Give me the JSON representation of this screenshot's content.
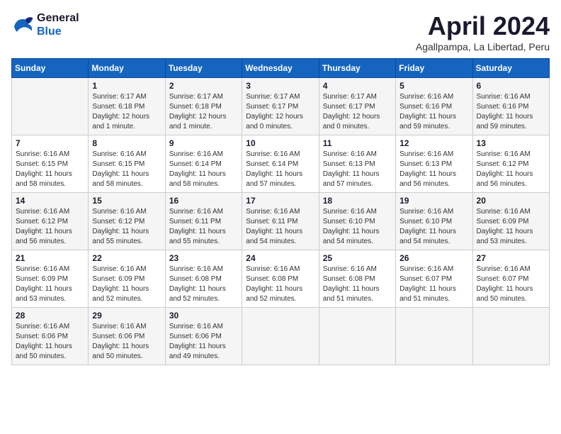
{
  "logo": {
    "line1": "General",
    "line2": "Blue"
  },
  "title": "April 2024",
  "subtitle": "Agallpampa, La Libertad, Peru",
  "days_of_week": [
    "Sunday",
    "Monday",
    "Tuesday",
    "Wednesday",
    "Thursday",
    "Friday",
    "Saturday"
  ],
  "weeks": [
    [
      {
        "day": "",
        "info": ""
      },
      {
        "day": "1",
        "info": "Sunrise: 6:17 AM\nSunset: 6:18 PM\nDaylight: 12 hours\nand 1 minute."
      },
      {
        "day": "2",
        "info": "Sunrise: 6:17 AM\nSunset: 6:18 PM\nDaylight: 12 hours\nand 1 minute."
      },
      {
        "day": "3",
        "info": "Sunrise: 6:17 AM\nSunset: 6:17 PM\nDaylight: 12 hours\nand 0 minutes."
      },
      {
        "day": "4",
        "info": "Sunrise: 6:17 AM\nSunset: 6:17 PM\nDaylight: 12 hours\nand 0 minutes."
      },
      {
        "day": "5",
        "info": "Sunrise: 6:16 AM\nSunset: 6:16 PM\nDaylight: 11 hours\nand 59 minutes."
      },
      {
        "day": "6",
        "info": "Sunrise: 6:16 AM\nSunset: 6:16 PM\nDaylight: 11 hours\nand 59 minutes."
      }
    ],
    [
      {
        "day": "7",
        "info": "Sunrise: 6:16 AM\nSunset: 6:15 PM\nDaylight: 11 hours\nand 58 minutes."
      },
      {
        "day": "8",
        "info": "Sunrise: 6:16 AM\nSunset: 6:15 PM\nDaylight: 11 hours\nand 58 minutes."
      },
      {
        "day": "9",
        "info": "Sunrise: 6:16 AM\nSunset: 6:14 PM\nDaylight: 11 hours\nand 58 minutes."
      },
      {
        "day": "10",
        "info": "Sunrise: 6:16 AM\nSunset: 6:14 PM\nDaylight: 11 hours\nand 57 minutes."
      },
      {
        "day": "11",
        "info": "Sunrise: 6:16 AM\nSunset: 6:13 PM\nDaylight: 11 hours\nand 57 minutes."
      },
      {
        "day": "12",
        "info": "Sunrise: 6:16 AM\nSunset: 6:13 PM\nDaylight: 11 hours\nand 56 minutes."
      },
      {
        "day": "13",
        "info": "Sunrise: 6:16 AM\nSunset: 6:12 PM\nDaylight: 11 hours\nand 56 minutes."
      }
    ],
    [
      {
        "day": "14",
        "info": "Sunrise: 6:16 AM\nSunset: 6:12 PM\nDaylight: 11 hours\nand 56 minutes."
      },
      {
        "day": "15",
        "info": "Sunrise: 6:16 AM\nSunset: 6:12 PM\nDaylight: 11 hours\nand 55 minutes."
      },
      {
        "day": "16",
        "info": "Sunrise: 6:16 AM\nSunset: 6:11 PM\nDaylight: 11 hours\nand 55 minutes."
      },
      {
        "day": "17",
        "info": "Sunrise: 6:16 AM\nSunset: 6:11 PM\nDaylight: 11 hours\nand 54 minutes."
      },
      {
        "day": "18",
        "info": "Sunrise: 6:16 AM\nSunset: 6:10 PM\nDaylight: 11 hours\nand 54 minutes."
      },
      {
        "day": "19",
        "info": "Sunrise: 6:16 AM\nSunset: 6:10 PM\nDaylight: 11 hours\nand 54 minutes."
      },
      {
        "day": "20",
        "info": "Sunrise: 6:16 AM\nSunset: 6:09 PM\nDaylight: 11 hours\nand 53 minutes."
      }
    ],
    [
      {
        "day": "21",
        "info": "Sunrise: 6:16 AM\nSunset: 6:09 PM\nDaylight: 11 hours\nand 53 minutes."
      },
      {
        "day": "22",
        "info": "Sunrise: 6:16 AM\nSunset: 6:09 PM\nDaylight: 11 hours\nand 52 minutes."
      },
      {
        "day": "23",
        "info": "Sunrise: 6:16 AM\nSunset: 6:08 PM\nDaylight: 11 hours\nand 52 minutes."
      },
      {
        "day": "24",
        "info": "Sunrise: 6:16 AM\nSunset: 6:08 PM\nDaylight: 11 hours\nand 52 minutes."
      },
      {
        "day": "25",
        "info": "Sunrise: 6:16 AM\nSunset: 6:08 PM\nDaylight: 11 hours\nand 51 minutes."
      },
      {
        "day": "26",
        "info": "Sunrise: 6:16 AM\nSunset: 6:07 PM\nDaylight: 11 hours\nand 51 minutes."
      },
      {
        "day": "27",
        "info": "Sunrise: 6:16 AM\nSunset: 6:07 PM\nDaylight: 11 hours\nand 50 minutes."
      }
    ],
    [
      {
        "day": "28",
        "info": "Sunrise: 6:16 AM\nSunset: 6:06 PM\nDaylight: 11 hours\nand 50 minutes."
      },
      {
        "day": "29",
        "info": "Sunrise: 6:16 AM\nSunset: 6:06 PM\nDaylight: 11 hours\nand 50 minutes."
      },
      {
        "day": "30",
        "info": "Sunrise: 6:16 AM\nSunset: 6:06 PM\nDaylight: 11 hours\nand 49 minutes."
      },
      {
        "day": "",
        "info": ""
      },
      {
        "day": "",
        "info": ""
      },
      {
        "day": "",
        "info": ""
      },
      {
        "day": "",
        "info": ""
      }
    ]
  ]
}
